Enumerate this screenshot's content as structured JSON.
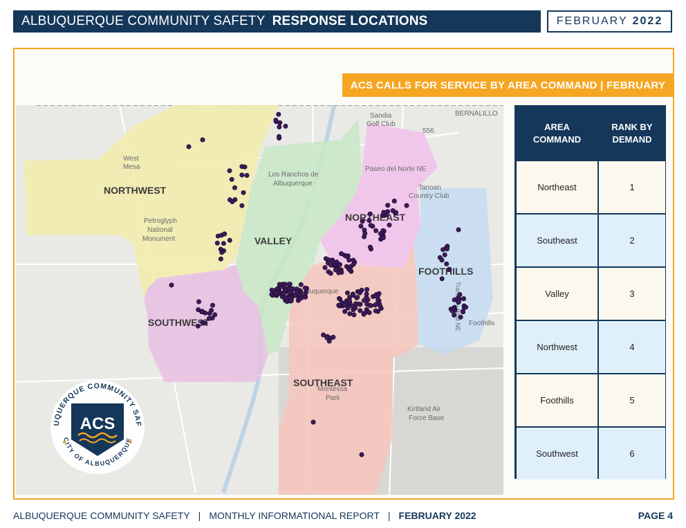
{
  "header": {
    "title_light": "ALBUQUERQUE COMMUNITY SAFETY",
    "title_bold": "RESPONSE LOCATIONS",
    "month": "FEBRUARY",
    "year": "2022"
  },
  "banner": "ACS CALLS FOR SERVICE BY AREA COMMAND | FEBRUARY",
  "map": {
    "area_labels": [
      "NORTHWEST",
      "VALLEY",
      "NORTHEAST",
      "FOOTHILLS",
      "SOUTHWEST",
      "SOUTHEAST"
    ],
    "place_labels": [
      "Sandia",
      "Golf Club",
      "BERNALILLO",
      "556",
      "West",
      "Mesa",
      "Los Ranchos de",
      "Albuquerque",
      "Paseo del Norte NE",
      "Tanoan",
      "Country Club",
      "Petroglyph",
      "National",
      "Monument",
      "Albuquerque",
      "Montessa",
      "Park",
      "Kirtland Air",
      "Force Base",
      "Foothills",
      "Tramway Blvd NE"
    ],
    "area_colors": {
      "northwest": "#f2ecaa",
      "valley": "#c8e8c6",
      "northeast": "#f0c2ea",
      "foothills": "#c6dcf2",
      "southwest": "#e8c0e2",
      "southeast": "#f6c6bc"
    },
    "dot_color": "#3c1a5a"
  },
  "logo": {
    "ring_top": "ALBUQUERQUE COMMUNITY SAFETY",
    "ring_bottom": "CITY OF ALBUQUERQUE",
    "initials": "ACS"
  },
  "table": {
    "col1": [
      "AREA",
      "COMMAND"
    ],
    "col2": [
      "RANK BY",
      "DEMAND"
    ],
    "rows": [
      {
        "area": "Northeast",
        "rank": "1"
      },
      {
        "area": "Southeast",
        "rank": "2"
      },
      {
        "area": "Valley",
        "rank": "3"
      },
      {
        "area": "Northwest",
        "rank": "4"
      },
      {
        "area": "Foothills",
        "rank": "5"
      },
      {
        "area": "Southwest",
        "rank": "6"
      }
    ]
  },
  "footer": {
    "org": "ALBUQUERQUE COMMUNITY SAFETY",
    "report": "MONTHLY INFORMATIONAL REPORT",
    "date": "FEBRUARY 2022",
    "page": "PAGE 4"
  }
}
